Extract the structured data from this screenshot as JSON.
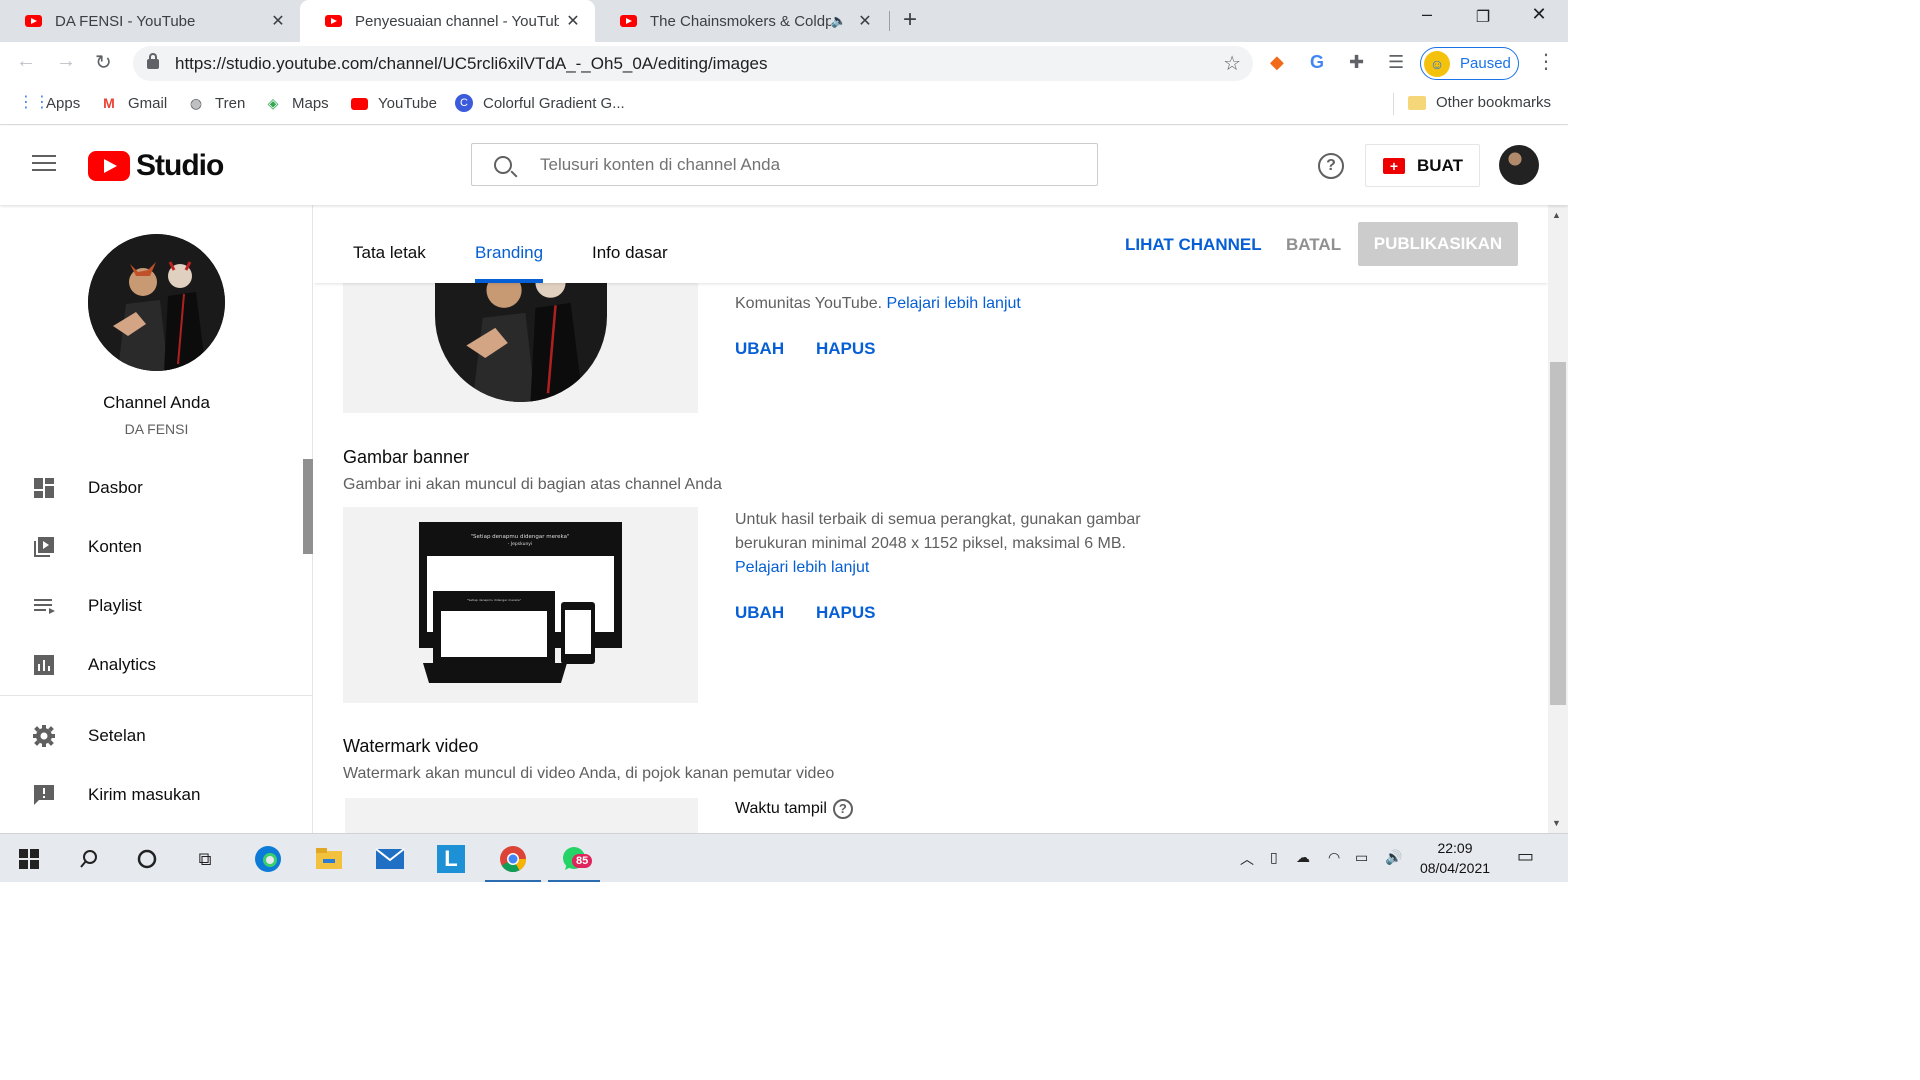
{
  "browser": {
    "tabs": [
      {
        "title": "DA FENSI - YouTube",
        "active": false,
        "audio": false
      },
      {
        "title": "Penyesuaian channel - YouTube Studio",
        "active": true,
        "audio": false
      },
      {
        "title": "The Chainsmokers & Coldplay",
        "active": false,
        "audio": true
      }
    ],
    "url": "https://studio.youtube.com/channel/UC5rcli6xilVTdA_-_Oh5_0A/editing/images",
    "profile_label": "Paused",
    "bookmarks": [
      {
        "label": "Apps",
        "icon": "apps-grid-icon"
      },
      {
        "label": "Gmail",
        "icon": "gmail-icon"
      },
      {
        "label": "Tren",
        "icon": "globe-icon"
      },
      {
        "label": "Maps",
        "icon": "maps-icon"
      },
      {
        "label": "YouTube",
        "icon": "youtube-icon"
      },
      {
        "label": "Colorful Gradient G...",
        "icon": "c-logo-icon"
      }
    ],
    "other_bookmarks": "Other bookmarks"
  },
  "studio": {
    "logo_text": "Studio",
    "search_placeholder": "Telusuri konten di channel Anda",
    "create_label": "BUAT"
  },
  "sidebar": {
    "channel_title": "Channel Anda",
    "channel_name": "DA FENSI",
    "items": [
      {
        "label": "Dasbor",
        "icon": "dashboard-icon"
      },
      {
        "label": "Konten",
        "icon": "content-icon"
      },
      {
        "label": "Playlist",
        "icon": "playlist-icon"
      },
      {
        "label": "Analytics",
        "icon": "analytics-icon"
      },
      {
        "label": "Setelan",
        "icon": "gear-icon"
      },
      {
        "label": "Kirim masukan",
        "icon": "feedback-icon"
      }
    ]
  },
  "main": {
    "tabs": [
      "Tata letak",
      "Branding",
      "Info dasar"
    ],
    "active_tab": "Branding",
    "actions": {
      "view_channel": "LIHAT CHANNEL",
      "cancel": "BATAL",
      "publish": "PUBLIKASIKAN"
    },
    "profile_picture": {
      "info_partial": "Komunitas YouTube.",
      "learn_more": "Pelajari lebih lanjut",
      "change": "UBAH",
      "remove": "HAPUS"
    },
    "banner": {
      "title": "Gambar banner",
      "description": "Gambar ini akan muncul di bagian atas channel Anda",
      "info_line1": "Untuk hasil terbaik di semua perangkat, gunakan gambar",
      "info_line2": "berukuran minimal 2048 x 1152 piksel, maksimal 6 MB.",
      "learn_more": "Pelajari lebih lanjut",
      "change": "UBAH",
      "remove": "HAPUS",
      "preview_quote": "\"Setiap denapmu didengar mereka\"",
      "preview_author": "- Jepskunyi"
    },
    "watermark": {
      "title": "Watermark video",
      "description": "Watermark akan muncul di video Anda, di pojok kanan pemutar video",
      "display_time_label": "Waktu tampil"
    }
  },
  "taskbar": {
    "time": "22:09",
    "date": "08/04/2021",
    "whatsapp_badge": "85"
  },
  "colors": {
    "youtube_red": "#ff0000",
    "studio_blue": "#065fd4",
    "chrome_blue": "#1a73e8"
  }
}
